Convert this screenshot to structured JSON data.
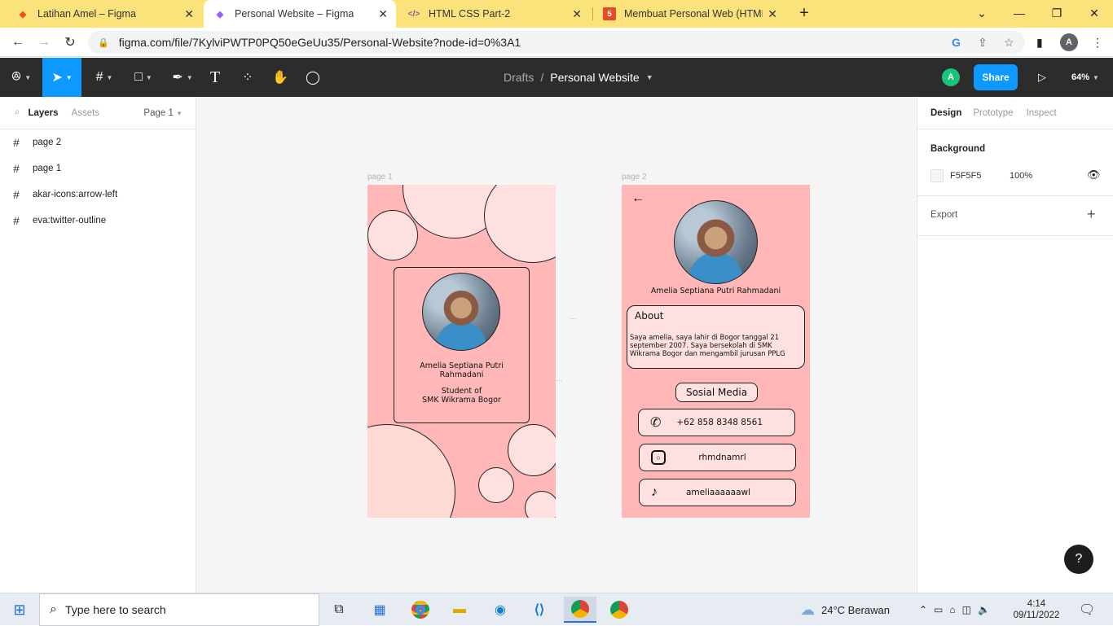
{
  "browser": {
    "tabs": [
      {
        "title": "Latihan Amel – Figma",
        "icon": "figma-icon"
      },
      {
        "title": "Personal Website – Figma",
        "icon": "figma-icon",
        "active": true
      },
      {
        "title": "HTML CSS Part-2",
        "icon": "code-icon"
      },
      {
        "title": "Membuat Personal Web (HTML d",
        "icon": "html5-icon"
      }
    ],
    "new_tab": "+",
    "url": "figma.com/file/7KylviPWTP0PQ50eGeUu35/Personal-Website?node-id=0%3A1",
    "profile_initial": "A"
  },
  "figma": {
    "breadcrumb_parent": "Drafts",
    "breadcrumb_sep": "/",
    "file_name": "Personal Website",
    "user_initial": "A",
    "share_label": "Share",
    "zoom": "64%",
    "left_tabs": {
      "layers": "Layers",
      "assets": "Assets",
      "page": "Page 1"
    },
    "layers": [
      "page 2",
      "page 1",
      "akar-icons:arrow-left",
      "eva:twitter-outline"
    ],
    "right_tabs": {
      "design": "Design",
      "prototype": "Prototype",
      "inspect": "Inspect"
    },
    "background_label": "Background",
    "background_hex": "F5F5F5",
    "background_opacity": "100%",
    "export_label": "Export",
    "help": "?"
  },
  "canvas": {
    "page1": {
      "label": "page 1",
      "name_line1": "Amelia Septiana Putri",
      "name_line2": "Rahmadani",
      "role_line1": "Student of",
      "role_line2": "SMK Wikrama Bogor"
    },
    "page2": {
      "label": "page 2",
      "name": "Amelia Septiana Putri Rahmadani",
      "about_title": "About",
      "about_line1": "Saya amelia, saya lahir di Bogor tanggal 21",
      "about_line2": "september 2007. Saya bersekolah di SMK",
      "about_line3": "Wikrama Bogor dan mengambil jurusan PPLG",
      "social_title": "Sosial Media",
      "whatsapp": "+62 858 8348 8561",
      "instagram": "rhmdnamrl",
      "tiktok": "ameliaaaaaawl"
    }
  },
  "taskbar": {
    "search_placeholder": "Type here to search",
    "weather": "24°C  Berawan",
    "time": "4:14",
    "date": "09/11/2022"
  },
  "colors": {
    "figma_blue": "#0d99ff",
    "frame_pink": "#ffb7b7",
    "tab_strip": "#fbe27a"
  }
}
